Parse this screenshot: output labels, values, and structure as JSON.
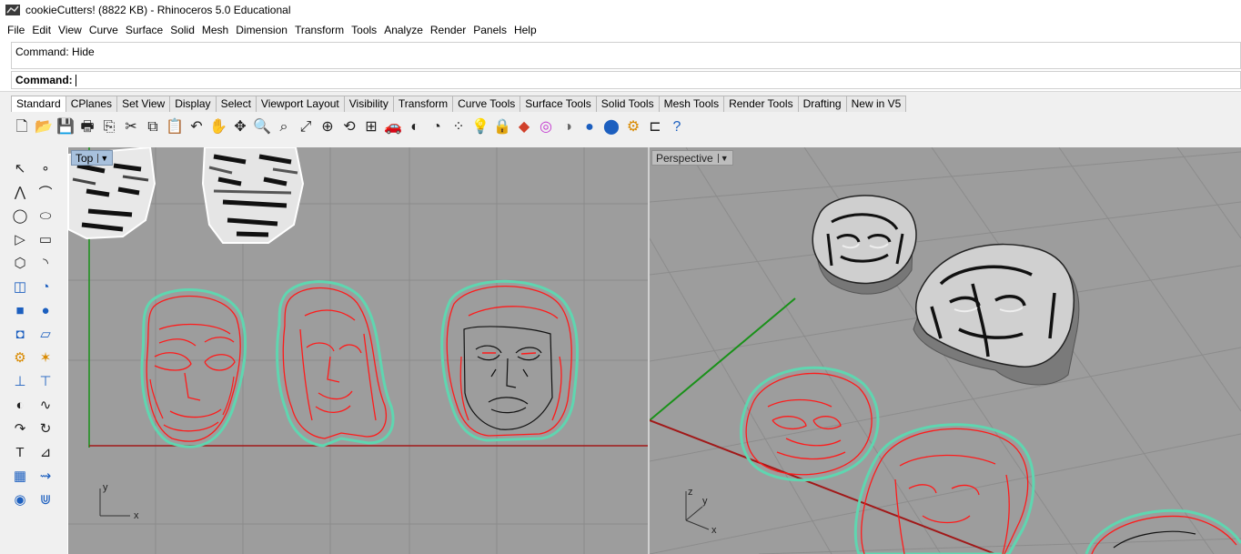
{
  "window": {
    "title": "cookieCutters! (8822 KB) - Rhinoceros 5.0 Educational"
  },
  "menu": [
    "File",
    "Edit",
    "View",
    "Curve",
    "Surface",
    "Solid",
    "Mesh",
    "Dimension",
    "Transform",
    "Tools",
    "Analyze",
    "Render",
    "Panels",
    "Help"
  ],
  "command": {
    "history": "Command: Hide",
    "prompt_label": "Command:",
    "value": ""
  },
  "tabs": [
    "Standard",
    "CPlanes",
    "Set View",
    "Display",
    "Select",
    "Viewport Layout",
    "Visibility",
    "Transform",
    "Curve Tools",
    "Surface Tools",
    "Solid Tools",
    "Mesh Tools",
    "Render Tools",
    "Drafting",
    "New in V5"
  ],
  "active_tab": "Standard",
  "toolbar_icons": [
    "new-icon",
    "open-icon",
    "save-icon",
    "print-icon",
    "import-icon",
    "cut-icon",
    "copy-icon",
    "paste-icon",
    "undo-icon",
    "pan-icon",
    "rotate-view-icon",
    "zoom-dynamic-icon",
    "zoom-window-icon",
    "zoom-extents-icon",
    "zoom-selected-icon",
    "named-views-icon",
    "viewport-layout-icon",
    "car-icon",
    "hide-icon",
    "shade-icon",
    "points-on-icon",
    "light-icon",
    "lock-icon",
    "layers-icon",
    "color-wheel-icon",
    "material-icon",
    "sphere-icon",
    "render-icon",
    "gear-icon",
    "dimension-icon",
    "help-icon"
  ],
  "left_tools": [
    "select-icon",
    "point-icon",
    "polyline-icon",
    "curve-icon",
    "circle-icon",
    "ellipse-icon",
    "polygon-icon",
    "rectangle-icon",
    "hexagon-icon",
    "fillet-icon",
    "surface-icon",
    "revolve-icon",
    "box-icon",
    "sphere-icon",
    "cylinder-icon",
    "extrude-icon",
    "boolean-icon",
    "explode-icon",
    "trim-icon",
    "split-icon",
    "shell-icon",
    "blend-icon",
    "curve-offset-icon",
    "curve-fillet-icon",
    "text-icon",
    "dimension-icon",
    "array-icon",
    "flow-icon",
    "gumball-icon",
    "analysis-icon"
  ],
  "viewports": {
    "top": {
      "label": "Top",
      "axis_x": "x",
      "axis_y": "y"
    },
    "perspective": {
      "label": "Perspective",
      "axis_x": "x",
      "axis_y": "y",
      "axis_z": "z"
    }
  },
  "colors": {
    "viewport_bg": "#9d9d9d",
    "grid": "#8a8a8a",
    "curve_red": "#ff1a1a",
    "outline_teal": "#5fd6b0",
    "axis_red": "#a11818",
    "axis_green": "#199119"
  }
}
